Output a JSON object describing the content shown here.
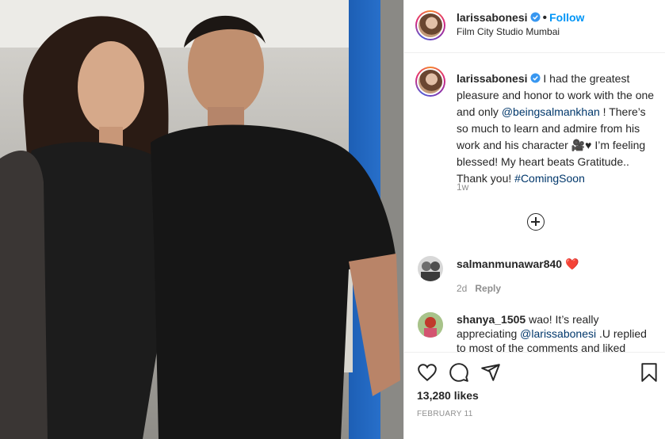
{
  "post": {
    "username": "larissabonesi",
    "location": "Film City Studio Mumbai",
    "follow_label": "Follow",
    "dot": "•",
    "more_label": "•••"
  },
  "caption": {
    "username": "larissabonesi",
    "text_1": " I had the greatest pleasure and honor to work with the one and only ",
    "mention": "@beingsalmankhan",
    "text_2": " ! There’s so much to learn and admire from his work and his character 🎥♥ I’m feeling blessed! My heart beats Gratitude.. Thank you! ",
    "hashtag": "#ComingSoon",
    "time": "1w"
  },
  "comments": [
    {
      "username": "salmanmunawar840",
      "text": " ❤️",
      "time": "2d",
      "reply_label": "Reply"
    },
    {
      "username": "shanya_1505",
      "text_1": " wao! It’s really appreciating ",
      "mention": "@larissabonesi",
      "text_2": " .U replied to most of the comments and liked"
    }
  ],
  "actions": {
    "likes": "13,280 likes",
    "date": "FEBRUARY 11"
  },
  "colors": {
    "accent": "#0095f6",
    "link": "#00376b",
    "muted": "#8e8e8e"
  }
}
